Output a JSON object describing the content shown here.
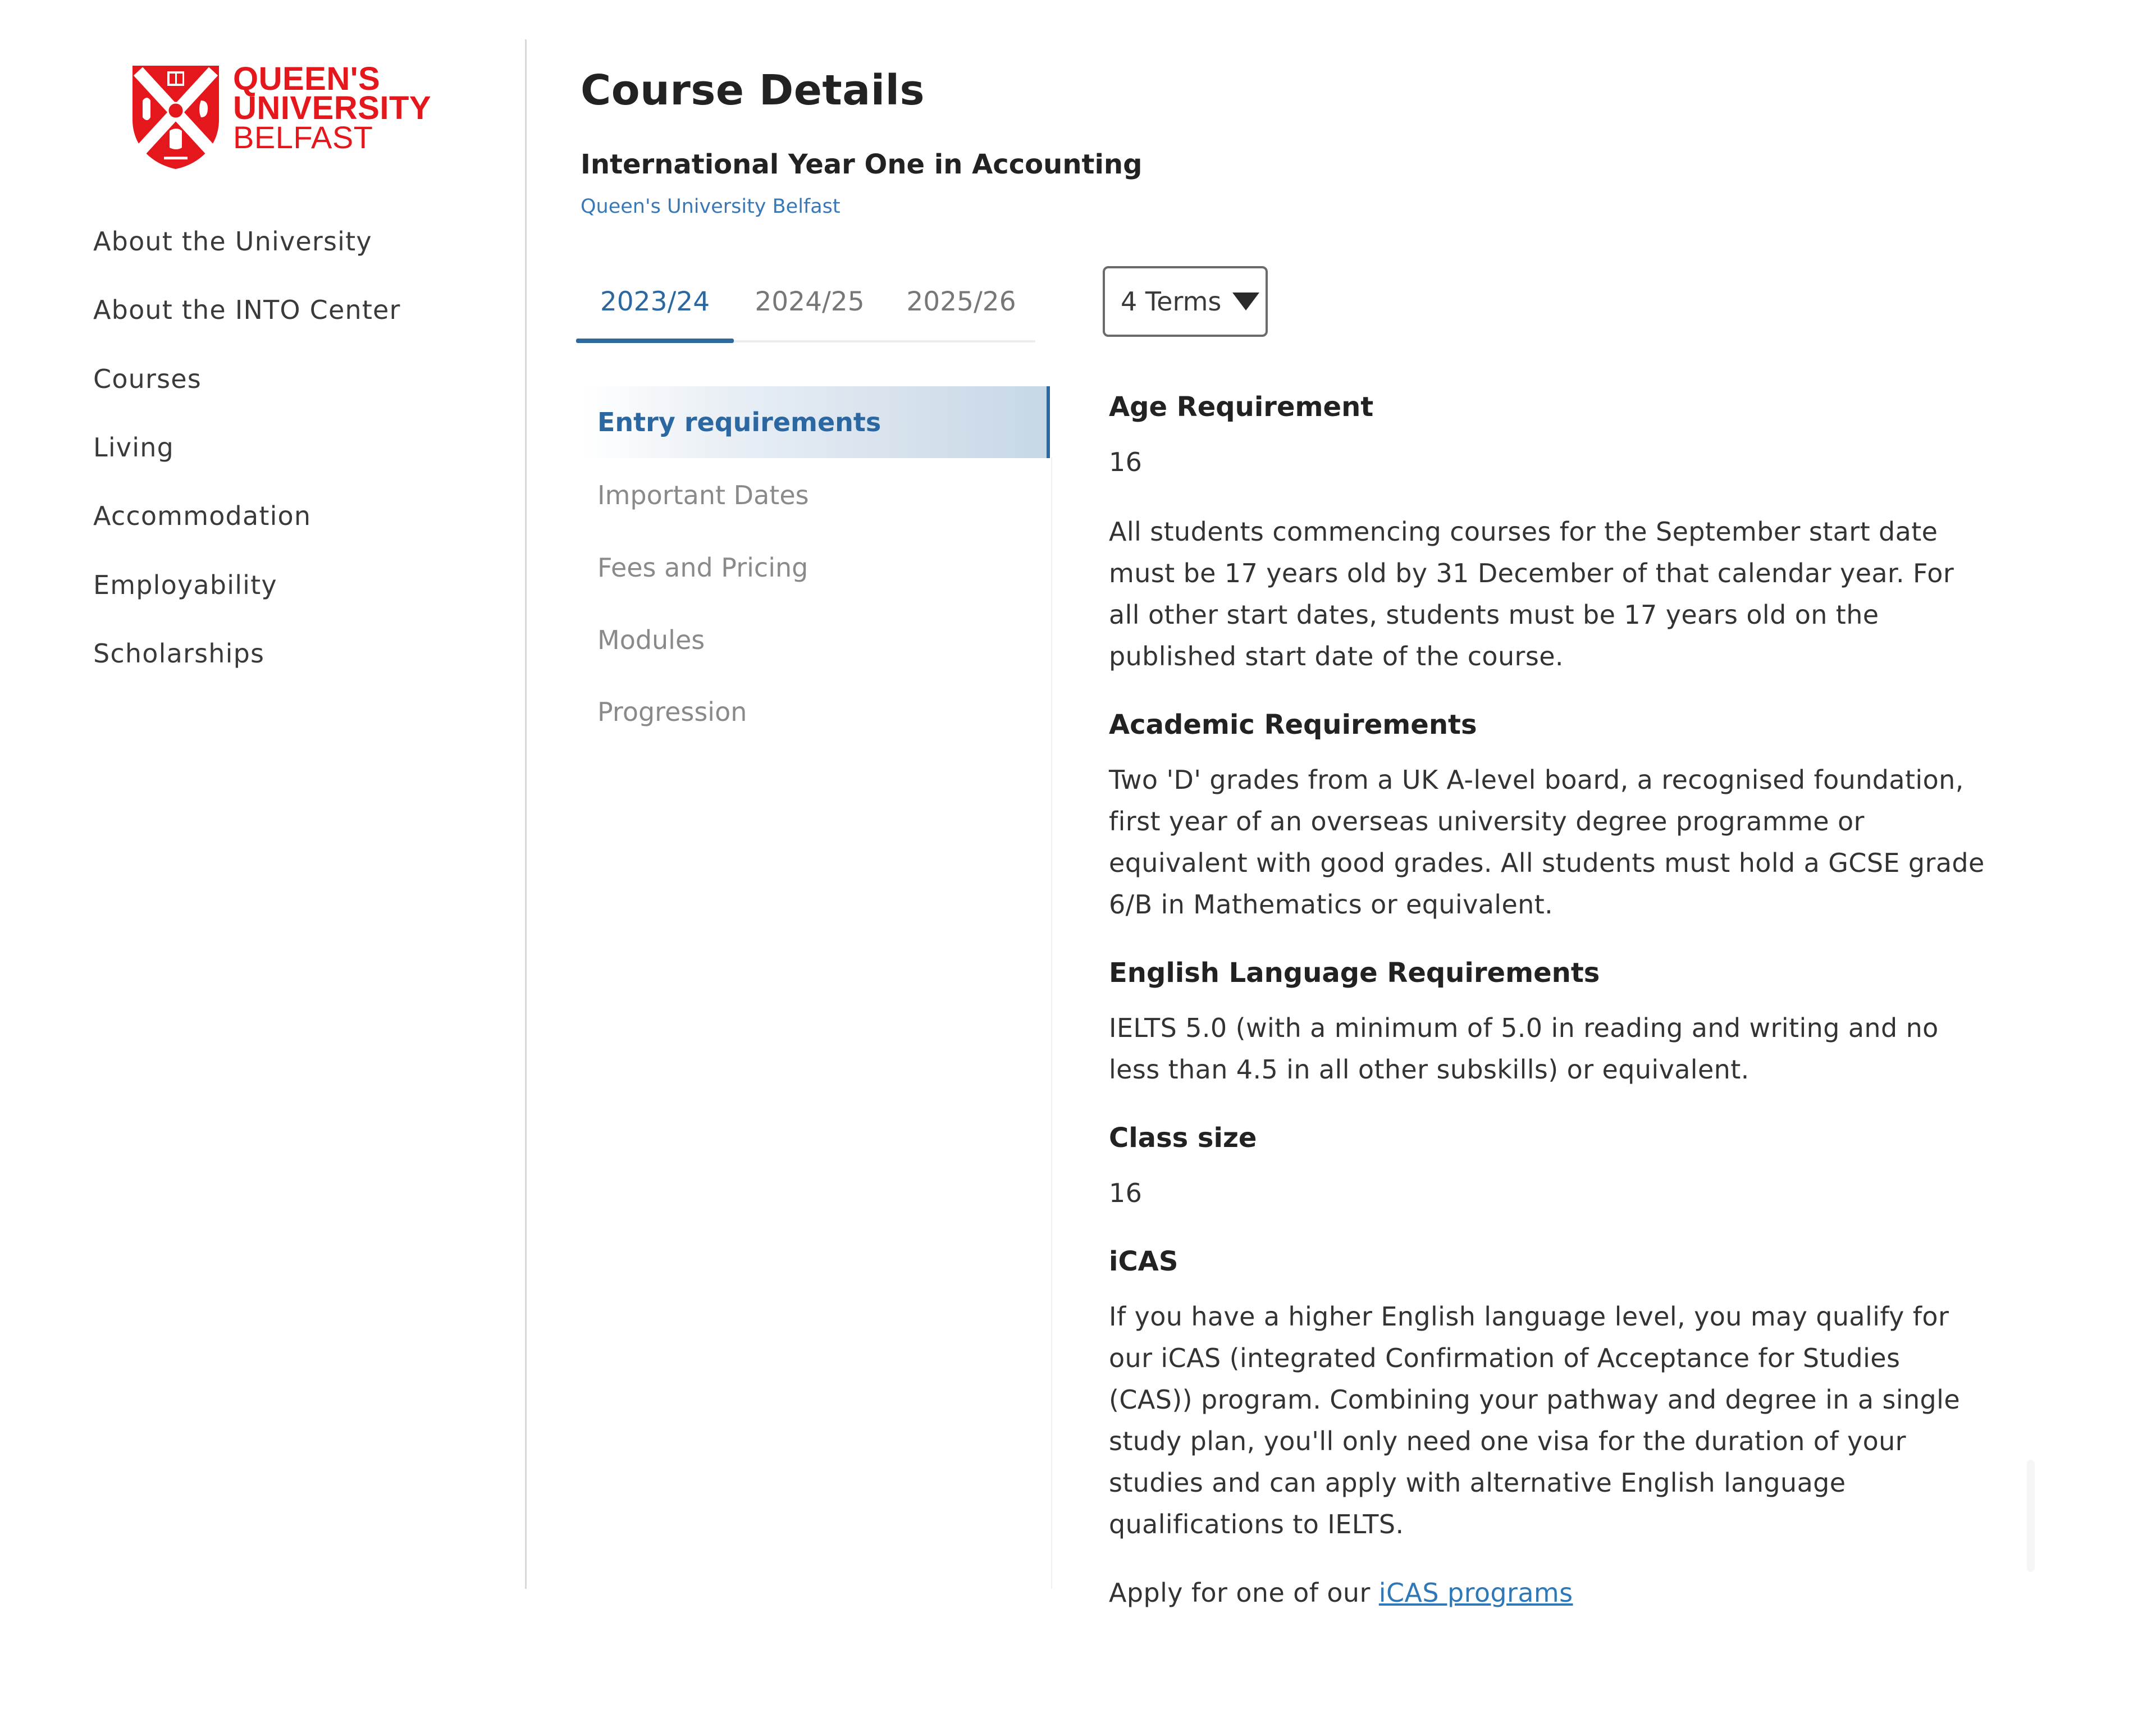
{
  "logo": {
    "line1": "QUEEN'S",
    "line2": "UNIVERSITY",
    "line3": "BELFAST",
    "icon": "university-crest-icon",
    "brand_color": "#e4171d"
  },
  "sidebar": {
    "items": [
      {
        "label": "About the University"
      },
      {
        "label": "About the INTO Center"
      },
      {
        "label": "Courses"
      },
      {
        "label": "Living"
      },
      {
        "label": "Accommodation"
      },
      {
        "label": "Employability"
      },
      {
        "label": "Scholarships"
      }
    ]
  },
  "header": {
    "title": "Course Details",
    "course_name": "International Year One in Accounting",
    "university_link": "Queen's University Belfast"
  },
  "year_tabs": {
    "tabs": [
      {
        "label": "2023/24",
        "active": true
      },
      {
        "label": "2024/25",
        "active": false
      },
      {
        "label": "2025/26",
        "active": false
      }
    ],
    "accent_color": "#2f689c"
  },
  "terms_dropdown": {
    "selected": "4 Terms",
    "icon": "caret-down-icon"
  },
  "section_nav": {
    "items": [
      {
        "label": "Entry requirements",
        "active": true
      },
      {
        "label": "Important Dates",
        "active": false
      },
      {
        "label": "Fees and Pricing",
        "active": false
      },
      {
        "label": "Modules",
        "active": false
      },
      {
        "label": "Progression",
        "active": false
      }
    ]
  },
  "content": {
    "age": {
      "heading": "Age Requirement",
      "value": "16",
      "text": "All students commencing courses for the September start date must be 17 years old by 31 December of that calendar year. For all other start dates, students must be 17 years old on the published start date of the course."
    },
    "academic": {
      "heading": "Academic Requirements",
      "text": "Two 'D' grades from a UK A-level board, a recognised foundation, first year of an overseas university degree programme or equivalent with good grades. All students must hold a GCSE grade 6/B in Mathematics or equivalent."
    },
    "english": {
      "heading": "English Language Requirements",
      "text": "IELTS 5.0 (with a minimum of 5.0 in reading and writing and no less than 4.5 in all other subskills) or equivalent."
    },
    "class_size": {
      "heading": "Class size",
      "value": "16"
    },
    "icas": {
      "heading": "iCAS",
      "text": "If you have a higher English language level, you may qualify for our iCAS (integrated Confirmation of Acceptance for Studies (CAS)) program. Combining your pathway and degree in a single study plan, you'll only need one visa for the duration of your studies and can apply with alternative English language qualifications to IELTS.",
      "apply_prefix": "Apply for one of our ",
      "apply_link": "iCAS programs"
    }
  }
}
